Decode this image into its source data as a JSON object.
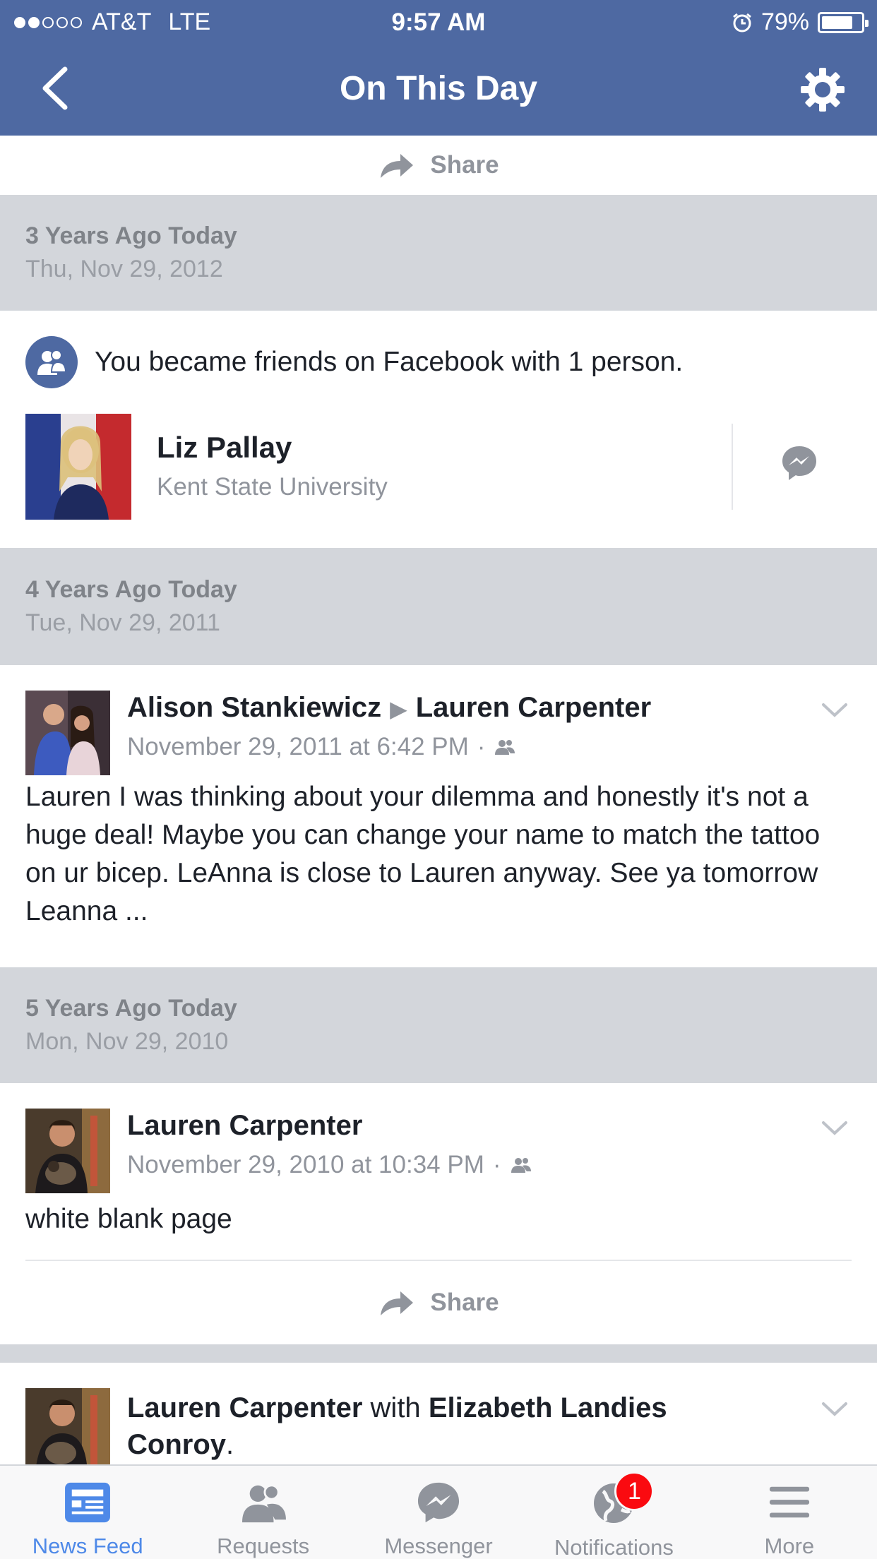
{
  "status_bar": {
    "carrier": "AT&T",
    "network": "LTE",
    "time": "9:57 AM",
    "battery": "79%",
    "battery_level": 0.79,
    "signal_bars_filled": 2,
    "signal_bars_total": 5
  },
  "nav": {
    "title": "On This Day"
  },
  "top_share": {
    "label": "Share"
  },
  "sections": [
    {
      "heading": "3 Years Ago Today",
      "date": "Thu, Nov 29, 2012"
    },
    {
      "heading": "4 Years Ago Today",
      "date": "Tue, Nov 29, 2011"
    },
    {
      "heading": "5 Years Ago Today",
      "date": "Mon, Nov 29, 2010"
    }
  ],
  "friendship": {
    "text": "You became friends on Facebook with 1 person.",
    "friend_name": "Liz Pallay",
    "friend_school": "Kent State University"
  },
  "post1": {
    "author": "Alison Stankiewicz",
    "target": "Lauren Carpenter",
    "timestamp": "November 29, 2011 at 6:42 PM",
    "body": "Lauren I was thinking about your dilemma and honestly it's not a huge deal! Maybe you can change your name to match the tattoo on ur bicep. LeAnna is close to Lauren anyway. See ya tomorrow Leanna ..."
  },
  "post2": {
    "author": "Lauren Carpenter",
    "timestamp": "November 29, 2010 at 10:34 PM",
    "body": "white blank page",
    "share_label": "Share"
  },
  "post3": {
    "author": "Lauren Carpenter",
    "with": "with",
    "tagged": "Elizabeth Landies Conroy",
    "period": "."
  },
  "tabbar": {
    "tabs": [
      {
        "label": "News Feed",
        "icon": "news-feed-icon",
        "active": true
      },
      {
        "label": "Requests",
        "icon": "requests-icon"
      },
      {
        "label": "Messenger",
        "icon": "messenger-icon"
      },
      {
        "label": "Notifications",
        "icon": "globe-icon",
        "badge": "1"
      },
      {
        "label": "More",
        "icon": "menu-icon"
      }
    ]
  },
  "colors": {
    "brand_blue": "#4e69a2",
    "section_gray": "#d3d6db",
    "active_tab": "#4e89e8",
    "badge_red": "#fa0a10"
  }
}
